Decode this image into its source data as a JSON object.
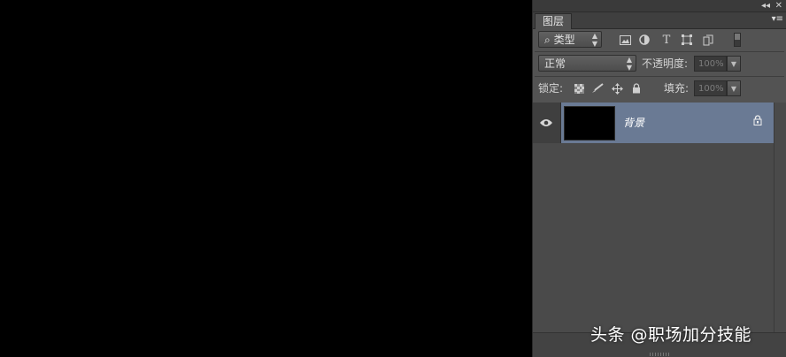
{
  "panel": {
    "collapse_label": "◂◂",
    "close_label": "✕",
    "menu_label": "▾≡",
    "tab_label": "图层",
    "filter": {
      "selected": "类型",
      "search_glyph": "⌕"
    },
    "filter_icons": [
      "image-filter-icon",
      "adjustment-filter-icon",
      "text-filter-icon",
      "shape-filter-icon",
      "smart-object-filter-icon"
    ],
    "blend_mode": "正常",
    "opacity_label": "不透明度:",
    "opacity_value": "100%",
    "lock_label": "锁定:",
    "fill_label": "填充:",
    "fill_value": "100%"
  },
  "layers": [
    {
      "name": "背景",
      "visible": true,
      "locked": true,
      "selected": true
    }
  ],
  "watermark": "头条 @职场加分技能",
  "colors": {
    "selection": "#6a7a94",
    "panel": "#535353",
    "canvas": "#000000"
  }
}
